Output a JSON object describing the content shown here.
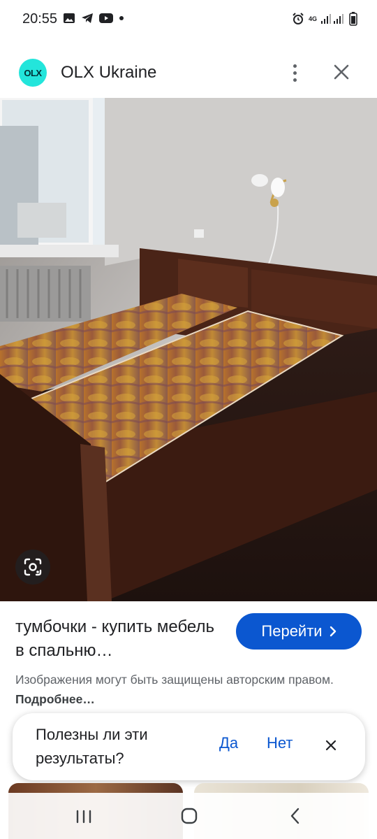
{
  "status_bar": {
    "time": "20:55",
    "network_label": "4G"
  },
  "header": {
    "logo_text": "OLX",
    "site_name": "OLX Ukraine"
  },
  "result": {
    "title": "тумбочки - купить мебель в спальню…",
    "goto_label": "Перейти",
    "copyright_text": "Изображения могут быть защищены авторским правом.",
    "learn_more_label": "Подробнее…"
  },
  "feedback": {
    "question": "Полезны ли эти результаты?",
    "yes_label": "Да",
    "no_label": "Нет"
  },
  "colors": {
    "accent": "#0b57d0",
    "olx_brand": "#23e5db",
    "text_primary": "#202124",
    "text_secondary": "#5f6368"
  },
  "icons": {
    "status": [
      "gallery-icon",
      "telegram-icon",
      "youtube-icon",
      "dot-icon",
      "alarm-icon",
      "signal-icon",
      "battery-icon"
    ],
    "header": [
      "olx-logo",
      "more-vert-icon",
      "close-icon"
    ],
    "image": [
      "lens-icon"
    ],
    "nav": [
      "recent-apps-icon",
      "home-icon",
      "back-icon"
    ]
  }
}
